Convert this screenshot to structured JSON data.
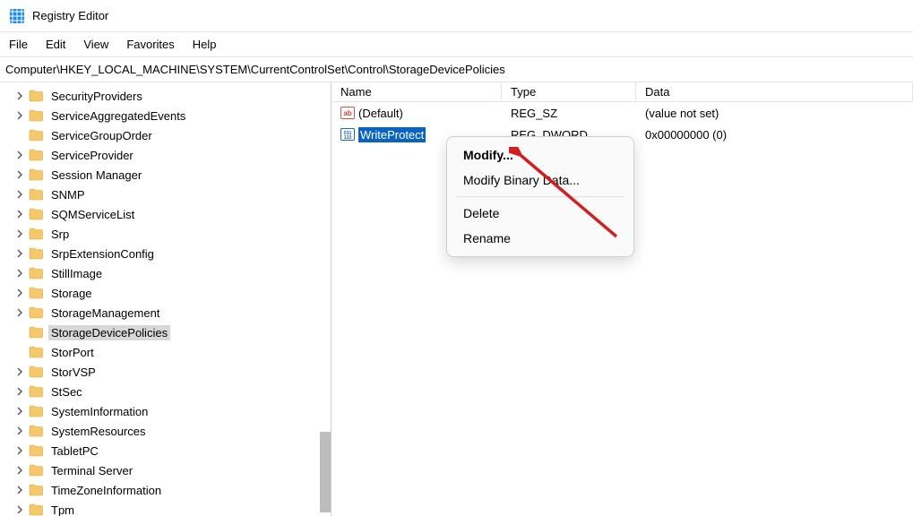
{
  "titlebar": {
    "title": "Registry Editor"
  },
  "menubar": {
    "file": "File",
    "edit": "Edit",
    "view": "View",
    "favorites": "Favorites",
    "help": "Help"
  },
  "addressbar": {
    "path": "Computer\\HKEY_LOCAL_MACHINE\\SYSTEM\\CurrentControlSet\\Control\\StorageDevicePolicies"
  },
  "tree": {
    "items": [
      {
        "label": "SecurityProviders",
        "expandable": true
      },
      {
        "label": "ServiceAggregatedEvents",
        "expandable": true
      },
      {
        "label": "ServiceGroupOrder",
        "expandable": false
      },
      {
        "label": "ServiceProvider",
        "expandable": true
      },
      {
        "label": "Session Manager",
        "expandable": true
      },
      {
        "label": "SNMP",
        "expandable": true
      },
      {
        "label": "SQMServiceList",
        "expandable": true
      },
      {
        "label": "Srp",
        "expandable": true
      },
      {
        "label": "SrpExtensionConfig",
        "expandable": true
      },
      {
        "label": "StillImage",
        "expandable": true
      },
      {
        "label": "Storage",
        "expandable": true
      },
      {
        "label": "StorageManagement",
        "expandable": true
      },
      {
        "label": "StorageDevicePolicies",
        "expandable": false,
        "active": true
      },
      {
        "label": "StorPort",
        "expandable": false
      },
      {
        "label": "StorVSP",
        "expandable": true
      },
      {
        "label": "StSec",
        "expandable": true
      },
      {
        "label": "SystemInformation",
        "expandable": true
      },
      {
        "label": "SystemResources",
        "expandable": true
      },
      {
        "label": "TabletPC",
        "expandable": true
      },
      {
        "label": "Terminal Server",
        "expandable": true
      },
      {
        "label": "TimeZoneInformation",
        "expandable": true
      },
      {
        "label": "Tpm",
        "expandable": true
      }
    ]
  },
  "list": {
    "columns": {
      "name": "Name",
      "type": "Type",
      "data": "Data"
    },
    "rows": [
      {
        "icon": "string",
        "name": "(Default)",
        "type": "REG_SZ",
        "data": "(value not set)",
        "selected": false
      },
      {
        "icon": "binary",
        "name": "WriteProtect",
        "type": "REG_DWORD",
        "data": "0x00000000 (0)",
        "selected": true
      }
    ]
  },
  "context_menu": {
    "modify": "Modify...",
    "modify_binary": "Modify Binary Data...",
    "delete": "Delete",
    "rename": "Rename"
  },
  "icons": {
    "chev_right": "›"
  }
}
